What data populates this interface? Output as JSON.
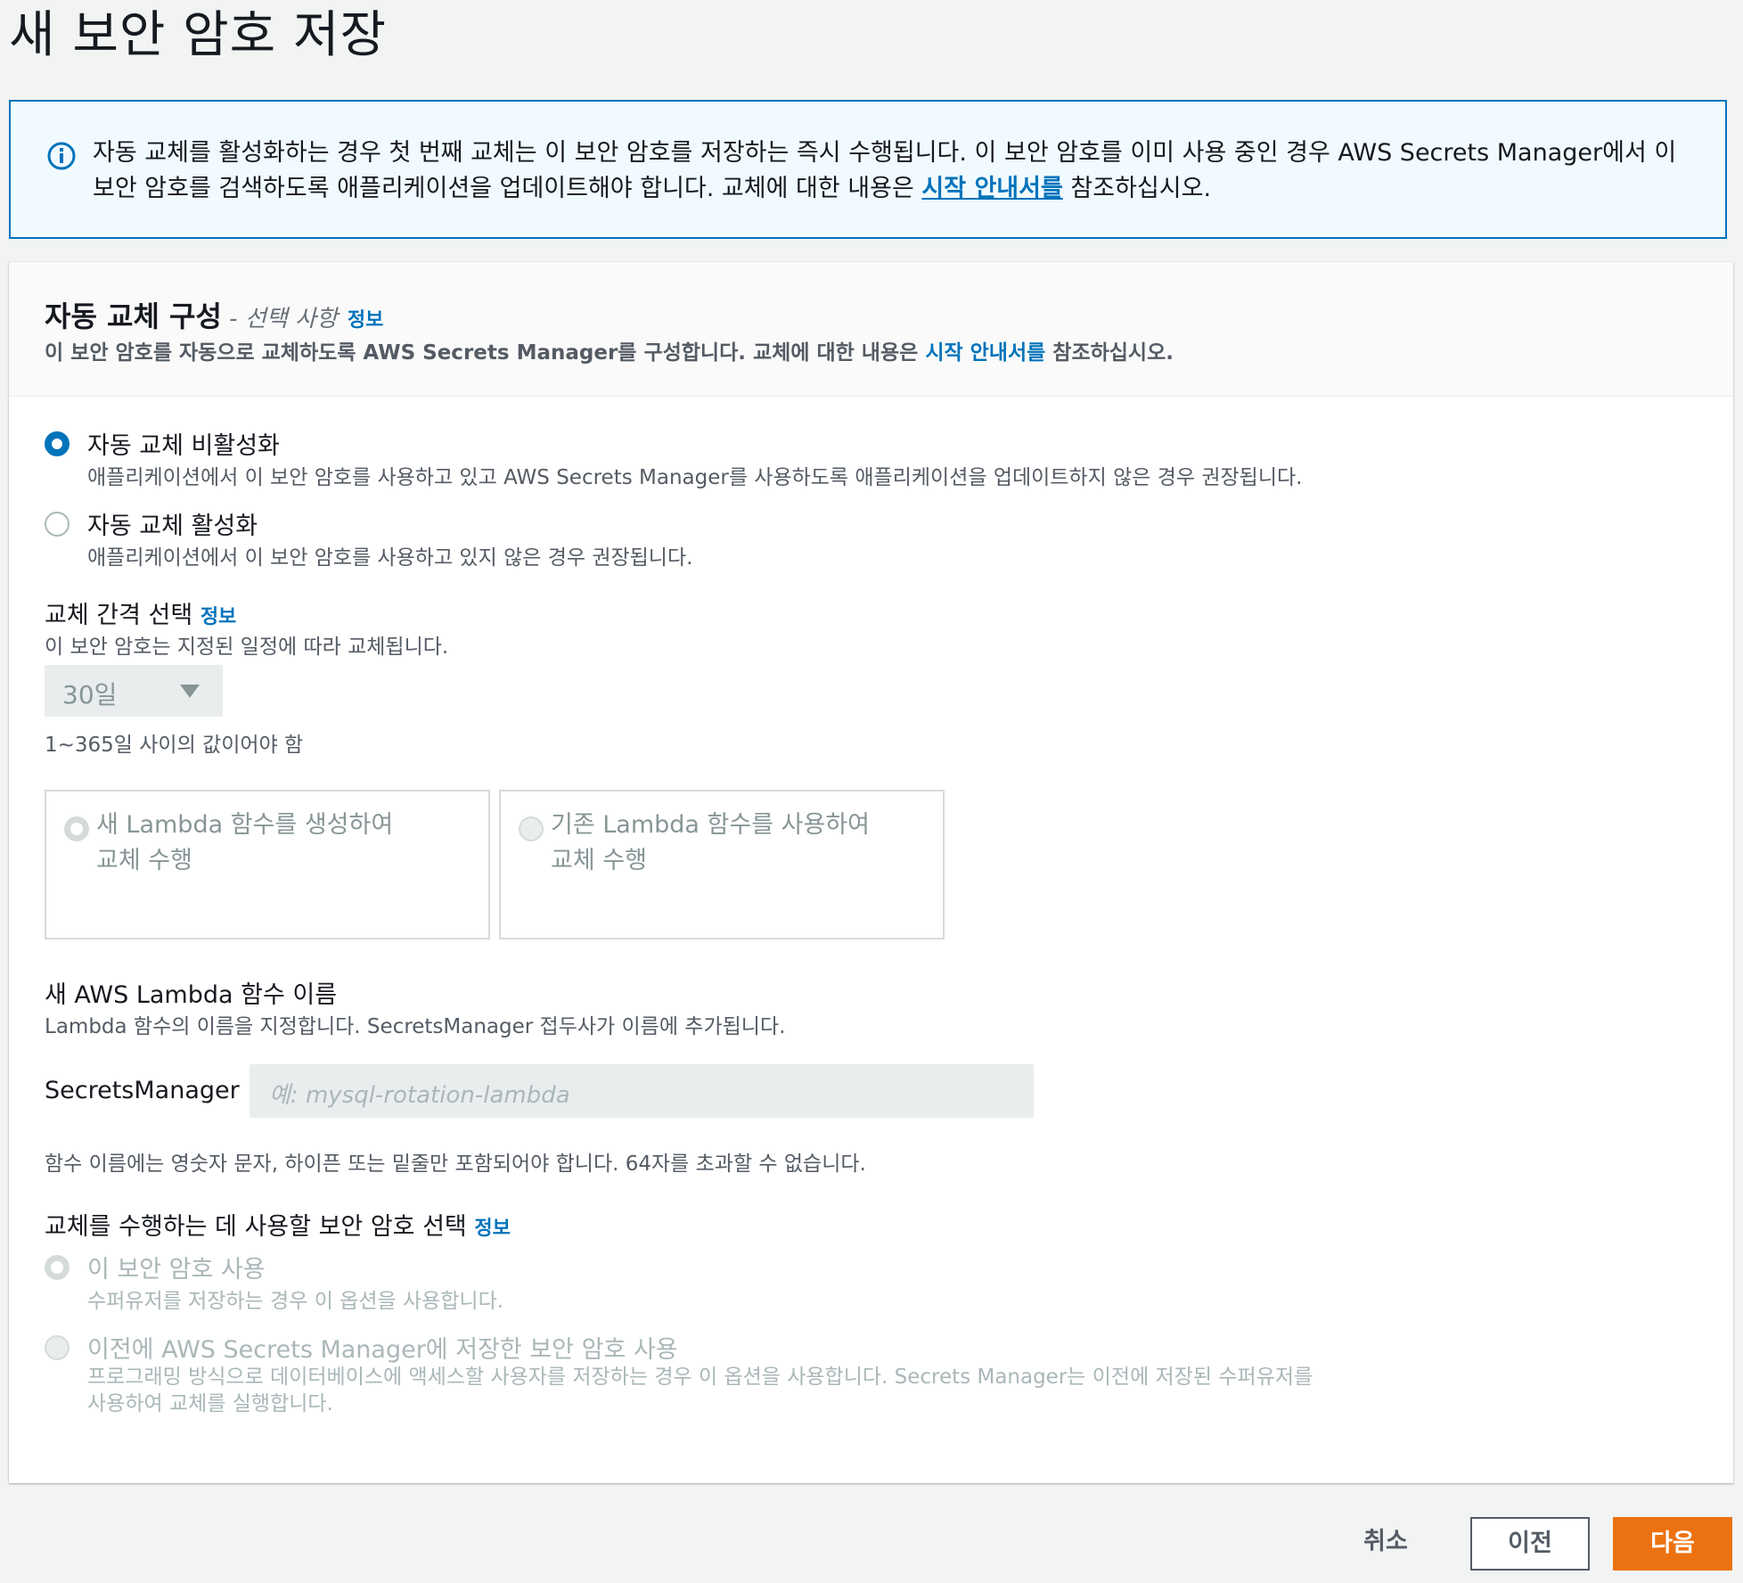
{
  "page": {
    "title": "새 보안 암호 저장"
  },
  "alert": {
    "text_before": "자동 교체를 활성화하는 경우 첫 번째 교체는 이 보안 암호를 저장하는 즉시 수행됩니다. 이 보안 암호를 이미 사용 중인 경우 AWS Secrets Manager에서 이 보안 암호를 검색하도록 애플리케이션을 업데이트해야 합니다. 교체에 대한 내용은 ",
    "link": "시작 안내서를",
    "text_after": " 참조하십시오."
  },
  "panel": {
    "title": "자동 교체 구성",
    "optional": " - 선택 사항",
    "info": "정보",
    "desc_before": "이 보안 암호를 자동으로 교체하도록 AWS Secrets Manager를 구성합니다. 교체에 대한 내용은 ",
    "desc_link": "시작 안내서를",
    "desc_after": " 참조하십시오."
  },
  "rotation": {
    "disable": {
      "label": "자동 교체 비활성화",
      "desc": "애플리케이션에서 이 보안 암호를 사용하고 있고 AWS Secrets Manager를 사용하도록 애플리케이션을 업데이트하지 않은 경우 권장됩니다."
    },
    "enable": {
      "label": "자동 교체 활성화",
      "desc": "애플리케이션에서 이 보안 암호를 사용하고 있지 않은 경우 권장됩니다."
    }
  },
  "interval": {
    "label": "교체 간격 선택",
    "info": "정보",
    "desc": "이 보안 암호는 지정된 일정에 따라 교체됩니다.",
    "value": "30일",
    "hint": "1~365일 사이의 값이어야 함"
  },
  "lambda_tiles": {
    "new": "새 Lambda 함수를 생성하여 교체 수행",
    "existing": "기존 Lambda 함수를 사용하여 교체 수행"
  },
  "lambda_name": {
    "label": "새 AWS Lambda 함수 이름",
    "desc": "Lambda 함수의 이름을 지정합니다. SecretsManager 접두사가 이름에 추가됩니다.",
    "prefix": "SecretsManager",
    "placeholder": "예: mysql-rotation-lambda",
    "hint": "함수 이름에는 영숫자 문자, 하이픈 또는 밑줄만 포함되어야 합니다. 64자를 초과할 수 없습니다."
  },
  "secret_choice": {
    "label": "교체를 수행하는 데 사용할 보안 암호 선택",
    "info": "정보",
    "this_secret": {
      "label": "이 보안 암호 사용",
      "desc": "수퍼유저를 저장하는 경우 이 옵션을 사용합니다."
    },
    "previous_secret": {
      "label": "이전에 AWS Secrets Manager에 저장한 보안 암호 사용",
      "desc": "프로그래밍 방식으로 데이터베이스에 액세스할 사용자를 저장하는 경우 이 옵션을 사용합니다. Secrets Manager는 이전에 저장된 수퍼유저를 사용하여 교체를 실행합니다."
    }
  },
  "footer": {
    "cancel": "취소",
    "previous": "이전",
    "next": "다음"
  },
  "colors": {
    "accent": "#0073bb",
    "primary_button": "#ec7211",
    "alert_bg": "#f1faff"
  }
}
